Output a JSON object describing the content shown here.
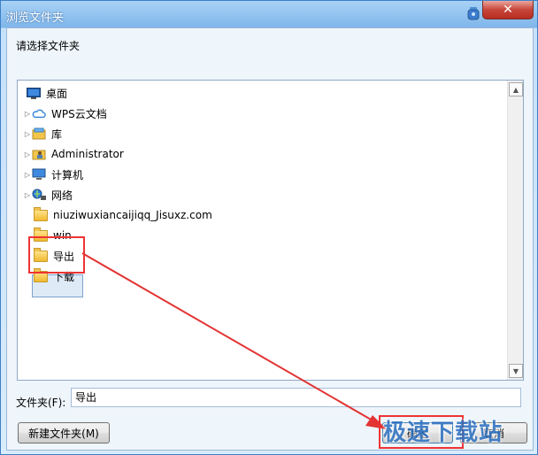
{
  "window": {
    "title": "浏览文件夹",
    "close_glyph": "✕"
  },
  "prompt": "请选择文件夹",
  "tree": [
    {
      "label": "桌面",
      "icon": "desktop-icon",
      "expander": false
    },
    {
      "label": "WPS云文档",
      "icon": "cloud-icon",
      "expander": true
    },
    {
      "label": "库",
      "icon": "library-icon",
      "expander": true
    },
    {
      "label": "Administrator",
      "icon": "user-folder-icon",
      "expander": true
    },
    {
      "label": "计算机",
      "icon": "computer-icon",
      "expander": true
    },
    {
      "label": "网络",
      "icon": "network-icon",
      "expander": true
    },
    {
      "label": "niuziwuxiancaijiqq_Jisuxz.com",
      "icon": "folder-icon",
      "expander": false
    },
    {
      "label": "win",
      "icon": "folder-icon",
      "expander": false
    },
    {
      "label": "导出",
      "icon": "folder-icon",
      "expander": false,
      "selected": true
    },
    {
      "label": "下载",
      "icon": "folder-icon",
      "expander": false
    }
  ],
  "folder_field": {
    "label": "文件夹(F):",
    "value": "导出"
  },
  "buttons": {
    "new_folder": "新建文件夹(M)",
    "ok": "确定",
    "cancel": "取消"
  },
  "watermark": "极速下载站",
  "colors": {
    "annotation_red": "#e33333",
    "selection": "#dfeaf7",
    "title_bar": "#7fb6ea"
  }
}
